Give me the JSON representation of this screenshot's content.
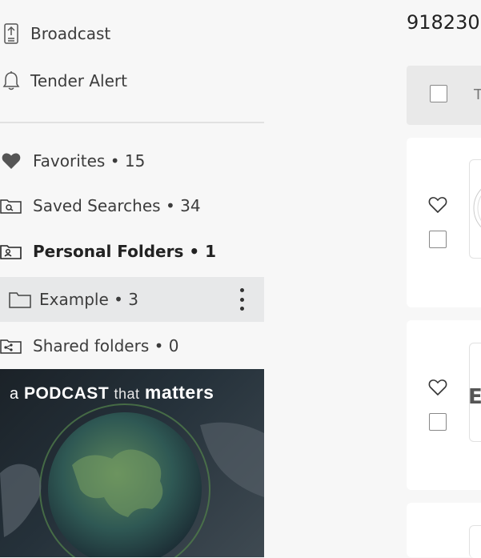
{
  "sidebar": {
    "nav": [
      {
        "label": "Broadcast",
        "icon": "broadcast-icon"
      },
      {
        "label": "Tender Alert",
        "icon": "bell-icon"
      }
    ],
    "folders": [
      {
        "label": "Favorites • 15",
        "icon": "heart-icon"
      },
      {
        "label": "Saved Searches • 34",
        "icon": "saved-search-icon"
      },
      {
        "label": "Personal Folders • 1",
        "icon": "personal-folder-icon"
      },
      {
        "label": "Example • 3",
        "icon": "folder-icon",
        "selected": true
      },
      {
        "label": "Shared folders • 0",
        "icon": "shared-folder-icon"
      }
    ]
  },
  "banner": {
    "a": "a",
    "podcast": "PODCAST",
    "that": "that",
    "matters": "matters"
  },
  "main": {
    "record_count": "918230",
    "toolbar_text": "T",
    "cards": [
      {
        "thumb_text": ""
      },
      {
        "thumb_text": "E"
      }
    ]
  },
  "colors": {
    "background": "#f7f7f7",
    "selected_row": "#e7e8e9",
    "banner_dark": "#1b2228"
  }
}
